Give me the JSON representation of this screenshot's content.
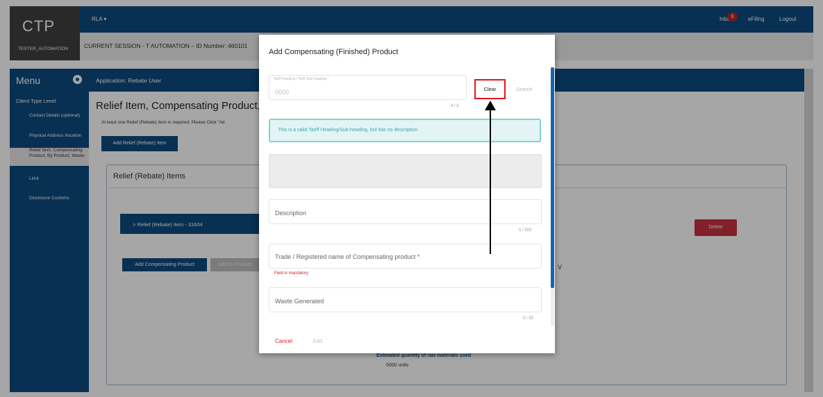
{
  "app": {
    "brand": "CTP",
    "user": "TESTER_AUTOMATION",
    "context_menu": "RLA ▾",
    "nav": {
      "inbox": "Inbox",
      "inbox_count": "9",
      "efiling": "eFiling",
      "logout": "Logout"
    },
    "session": "CURRENT SESSION - T AUTOMATION – ID Number: 460101"
  },
  "sidebar": {
    "title": "Menu",
    "level": "Client Type Level",
    "items": [
      {
        "label": "Contact Details (optional)"
      },
      {
        "label": "Physical Address /location"
      },
      {
        "label": "Relief Item, Compensating Product, By Product, Waste"
      },
      {
        "label": "Limit"
      },
      {
        "label": "Disclosure Customs"
      }
    ]
  },
  "main": {
    "application": "Application: Rebate User",
    "title": "Relief Item, Compensating Product, B",
    "info": "At least one Relief (Rebate) item is required. Please Click \"Ad",
    "add_relief_button": "Add Relief (Rebate) Item",
    "panel_title": "Relief (Rebate) Items",
    "relief_item": "> Relief (Rebate) item - 31604",
    "add_comp_button": "Add Compensating Product",
    "add_by_product_button": "Add By Product",
    "delete_button": "Delete",
    "v_label": "V",
    "est_label": "Estimated quantity of raw materials used",
    "est_value": "5000 units"
  },
  "modal": {
    "title": "Add Compensating (Finished) Product",
    "tariff": {
      "label": "Tariff Heading / Tariff Sub Heading *",
      "value": "0000",
      "counter": "4 / 8"
    },
    "clear_button": "Clear",
    "search_button": "Search",
    "alert": "This is a valid Tariff Heading/Sub-heading, but has no description",
    "description": {
      "placeholder": "Description",
      "counter": "0 / 500"
    },
    "trade_name": {
      "placeholder": "Trade / Registered name of Compensating product *",
      "error": "Field is mandatory"
    },
    "waste": {
      "placeholder": "Waste Generated",
      "counter": "0 / 50"
    },
    "cancel_button": "Cancel",
    "add_button": "Add"
  },
  "colors": {
    "primary": "#0d4a7e",
    "danger": "#e0161e",
    "alert_border": "#7fd2d2",
    "alert_text": "#3aa6ad"
  }
}
